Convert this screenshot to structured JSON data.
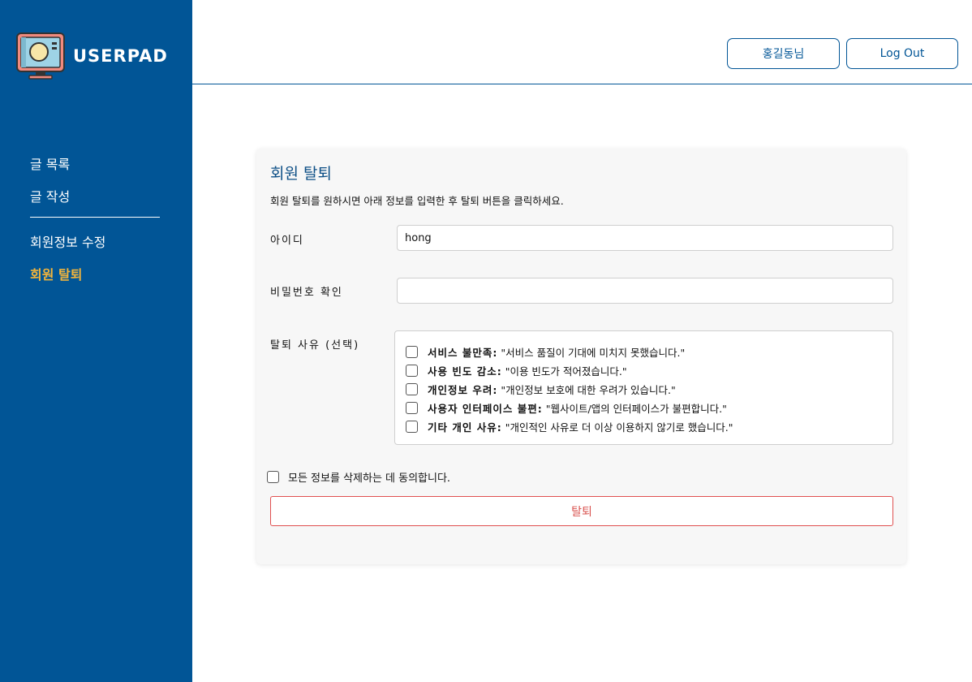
{
  "brand": {
    "name": "USERPAD",
    "logo_icon": "monitor-logo-icon"
  },
  "sidebar": {
    "items": [
      {
        "label": "글 목록",
        "active": false
      },
      {
        "label": "글 작성",
        "active": false
      },
      {
        "label": "회원정보 수정",
        "active": false
      },
      {
        "label": "회원 탈퇴",
        "active": true
      }
    ]
  },
  "header": {
    "user_button": "홍길동님",
    "logout_button": "Log Out"
  },
  "form": {
    "title": "회원 탈퇴",
    "description": "회원 탈퇴를 원하시면 아래 정보를 입력한 후 탈퇴 버튼을 클릭하세요.",
    "id_label": "아이디",
    "id_value": "hong",
    "password_label": "비밀번호 확인",
    "password_value": "",
    "reason_label": "탈퇴 사유 (선택)",
    "reasons": [
      {
        "title": "서비스 불만족:",
        "text": "\"서비스 품질이 기대에 미치지 못했습니다.\"",
        "checked": false
      },
      {
        "title": "사용 빈도 감소:",
        "text": "\"이용 빈도가 적어졌습니다.\"",
        "checked": false
      },
      {
        "title": "개인정보 우려:",
        "text": "\"개인정보 보호에 대한 우려가 있습니다.\"",
        "checked": false
      },
      {
        "title": "사용자 인터페이스 불편:",
        "text": "\"웹사이트/앱의 인터페이스가 불편합니다.\"",
        "checked": false
      },
      {
        "title": "기타 개인 사유:",
        "text": "\"개인적인 사유로 더 이상 이용하지 않기로 했습니다.\"",
        "checked": false
      }
    ],
    "agree_label": "모든 정보를 삭제하는 데 동의합니다.",
    "agree_checked": false,
    "submit_label": "탈퇴"
  },
  "colors": {
    "sidebar_bg": "#015596",
    "active_nav": "#f2b43c",
    "title": "#0d4f86",
    "danger": "#d9534f"
  }
}
